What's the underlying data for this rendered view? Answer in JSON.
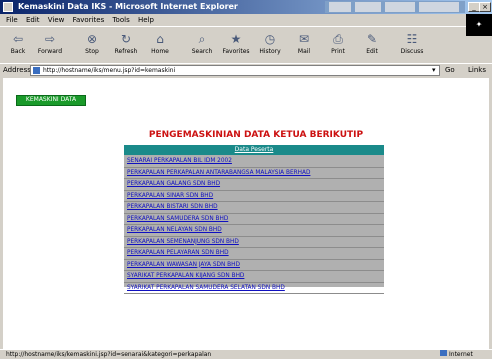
{
  "window": {
    "title": "Kemaskini Data IKS - Microsoft Internet Explorer"
  },
  "menu": [
    "File",
    "Edit",
    "View",
    "Favorites",
    "Tools",
    "Help"
  ],
  "toolbar": [
    {
      "label": "Back",
      "icon": "back-icon",
      "glyph": "⇦"
    },
    {
      "label": "Forward",
      "icon": "forward-icon",
      "glyph": "⇨"
    },
    {
      "label": "Stop",
      "icon": "stop-icon",
      "glyph": "⊗"
    },
    {
      "label": "Refresh",
      "icon": "refresh-icon",
      "glyph": "↻"
    },
    {
      "label": "Home",
      "icon": "home-icon",
      "glyph": "⌂"
    },
    {
      "label": "Search",
      "icon": "search-icon",
      "glyph": "⌕"
    },
    {
      "label": "Favorites",
      "icon": "favorites-icon",
      "glyph": "★"
    },
    {
      "label": "History",
      "icon": "history-icon",
      "glyph": "◷"
    },
    {
      "label": "Mail",
      "icon": "mail-icon",
      "glyph": "✉"
    },
    {
      "label": "Print",
      "icon": "print-icon",
      "glyph": "⎙"
    },
    {
      "label": "Edit",
      "icon": "edit-icon",
      "glyph": "✎"
    },
    {
      "label": "Discuss",
      "icon": "discuss-icon",
      "glyph": "☷"
    }
  ],
  "address": {
    "label": "Address",
    "url": "http://hostname/iks/menu.jsp?id=kemaskini",
    "go": "Go",
    "links": "Links"
  },
  "page": {
    "tag": "KEMASKINI DATA",
    "heading": "PENGEMASKINIAN DATA KETUA BERIKUTIP",
    "table_header": "Data Peserta",
    "items": [
      "SENARAI PERKAPALAN BIL IDM 2002",
      "PERKAPALAN PERKAPALAN ANTARABANGSA MALAYSIA BERHAD",
      "PERKAPALAN GALANG SDN BHD",
      "PERKAPALAN SINAR SDN BHD",
      "PERKAPALAN BISTARI SDN BHD",
      "PERKAPALAN SAMUDERA SDN BHD",
      "PERKAPALAN NELAYAN SDN BHD",
      "PERKAPALAN SEMENANJUNG SDN BHD",
      "PERKAPALAN PELAYARAN SDN BHD",
      "PERKAPALAN WAWASAN JAYA SDN BHD",
      "SYARIKAT PERKAPALAN KIJANG SDN BHD",
      "SYARIKAT PERKAPALAN SAMUDERA SELATAN SDN BHD"
    ]
  },
  "status": {
    "text": "http://hostname/iks/kemaskini.jsp?id=senarai&kategori=perkapalan",
    "zone": "Internet"
  },
  "colors": {
    "title_gradient_start": "#0a246a",
    "heading": "#cc1111",
    "table_header_bg": "#1a8a8a",
    "table_bg": "#b0b0b0",
    "link": "#1010c0",
    "tag_bg": "#1a9a2a"
  }
}
